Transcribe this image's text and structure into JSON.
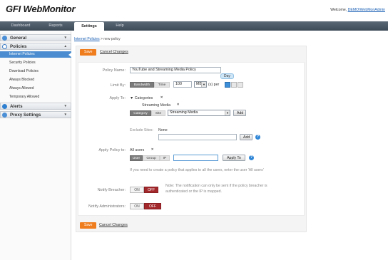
{
  "header": {
    "brand_gfi": "GFI",
    "brand_product": "WebMonitor",
    "welcome_text": "Welcome,",
    "welcome_user": "DEMO\\WebMonAdmin"
  },
  "nav": {
    "tabs": [
      "Dashboard",
      "Reports",
      "Settings",
      "Help"
    ],
    "active": "Settings"
  },
  "sidebar": {
    "general": "General",
    "policies": "Policies",
    "policy_items": [
      "Internet Policies",
      "Security Policies",
      "Download Policies",
      "Always Blocked",
      "Always Allowed",
      "Temporary Allowed"
    ],
    "alerts": "Alerts",
    "proxy": "Proxy Settings"
  },
  "breadcrumb": {
    "link": "Internet Policies",
    "current": "> new policy"
  },
  "actions": {
    "save": "Save",
    "cancel": "Cancel Changes"
  },
  "form": {
    "policy_name_label": "Policy Name:",
    "policy_name_value": "YouTube and Streaming Media Policy",
    "limit_by_label": "Limit By:",
    "limit_by_options": [
      "Bandwidth",
      "Time"
    ],
    "limit_value": "100",
    "limit_unit": "MB",
    "per_text": "(s) per",
    "period_tooltip": "Day",
    "apply_to_label": "Apply To:",
    "categories_label": "Categories",
    "category_chip": "Streaming Media",
    "apply_type_options": [
      "Category",
      "Site"
    ],
    "category_select_value": "Streaming Media",
    "add_button": "Add",
    "exclude_sites_label": "Exclude Sites:",
    "exclude_sites_value": "None",
    "apply_policy_label": "Apply Policy to:",
    "apply_policy_value": "All users",
    "user_type_options": [
      "User",
      "Group",
      "IP"
    ],
    "apply_to_button": "Apply To",
    "hint_text": "If you need to create a policy that applies to all the users, enter the user 'All users'",
    "notify_breacher_label": "Notify Breacher:",
    "notify_admins_label": "Notify Administrators:",
    "on": "ON",
    "off": "OFF",
    "note_line1": "Note: The notification can only be sent if the policy breacher is",
    "note_line2": "authenticated or the IP is mapped."
  },
  "colors": {
    "accent_orange": "#ef7d1d",
    "toggle_off_red": "#a3282c",
    "selected_blue": "#4a8ccf"
  }
}
